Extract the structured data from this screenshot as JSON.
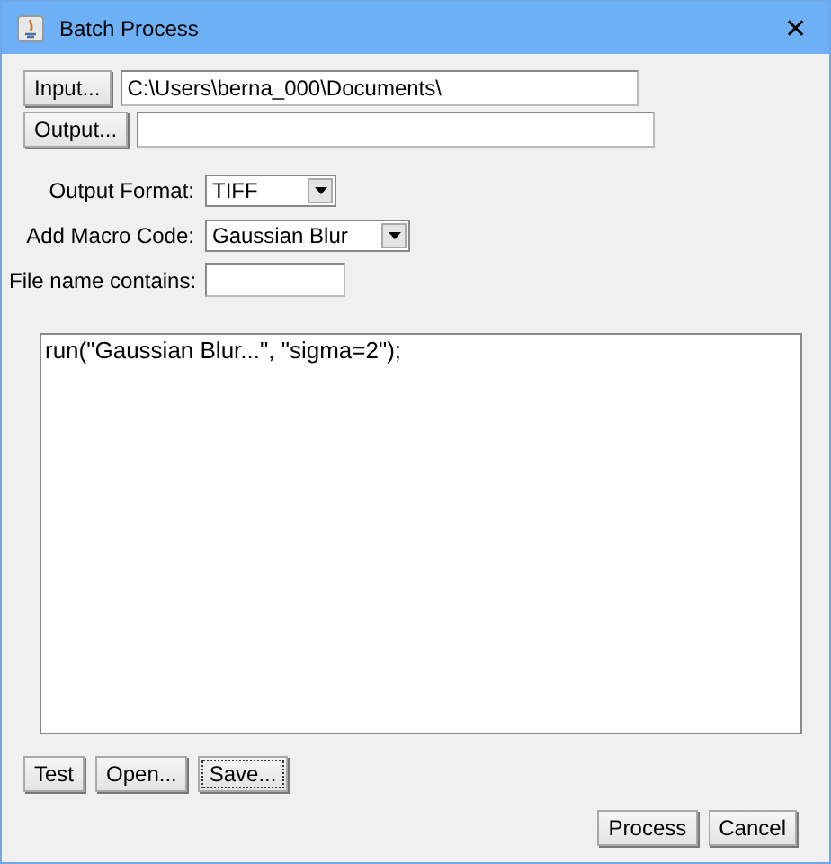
{
  "window": {
    "title": "Batch Process",
    "close": "✕"
  },
  "input": {
    "button": "Input...",
    "value": "C:\\Users\\berna_000\\Documents\\"
  },
  "output": {
    "button": "Output..."
  },
  "options": [
    {
      "kind": "select",
      "label": "Output Format:",
      "value": "TIFF"
    },
    {
      "kind": "select",
      "label": "Add Macro Code:",
      "value": "Gaussian Blur"
    },
    {
      "kind": "text",
      "label": "File name contains:"
    }
  ],
  "macro": "run(\"Gaussian Blur...\", \"sigma=2\");",
  "macro_buttons": [
    {
      "label": "Test",
      "focused": false
    },
    {
      "label": "Open...",
      "focused": false
    },
    {
      "label": "Save...",
      "focused": true
    }
  ],
  "dialog_buttons": [
    {
      "label": "Process",
      "focused": false
    },
    {
      "label": "Cancel",
      "focused": false
    }
  ]
}
